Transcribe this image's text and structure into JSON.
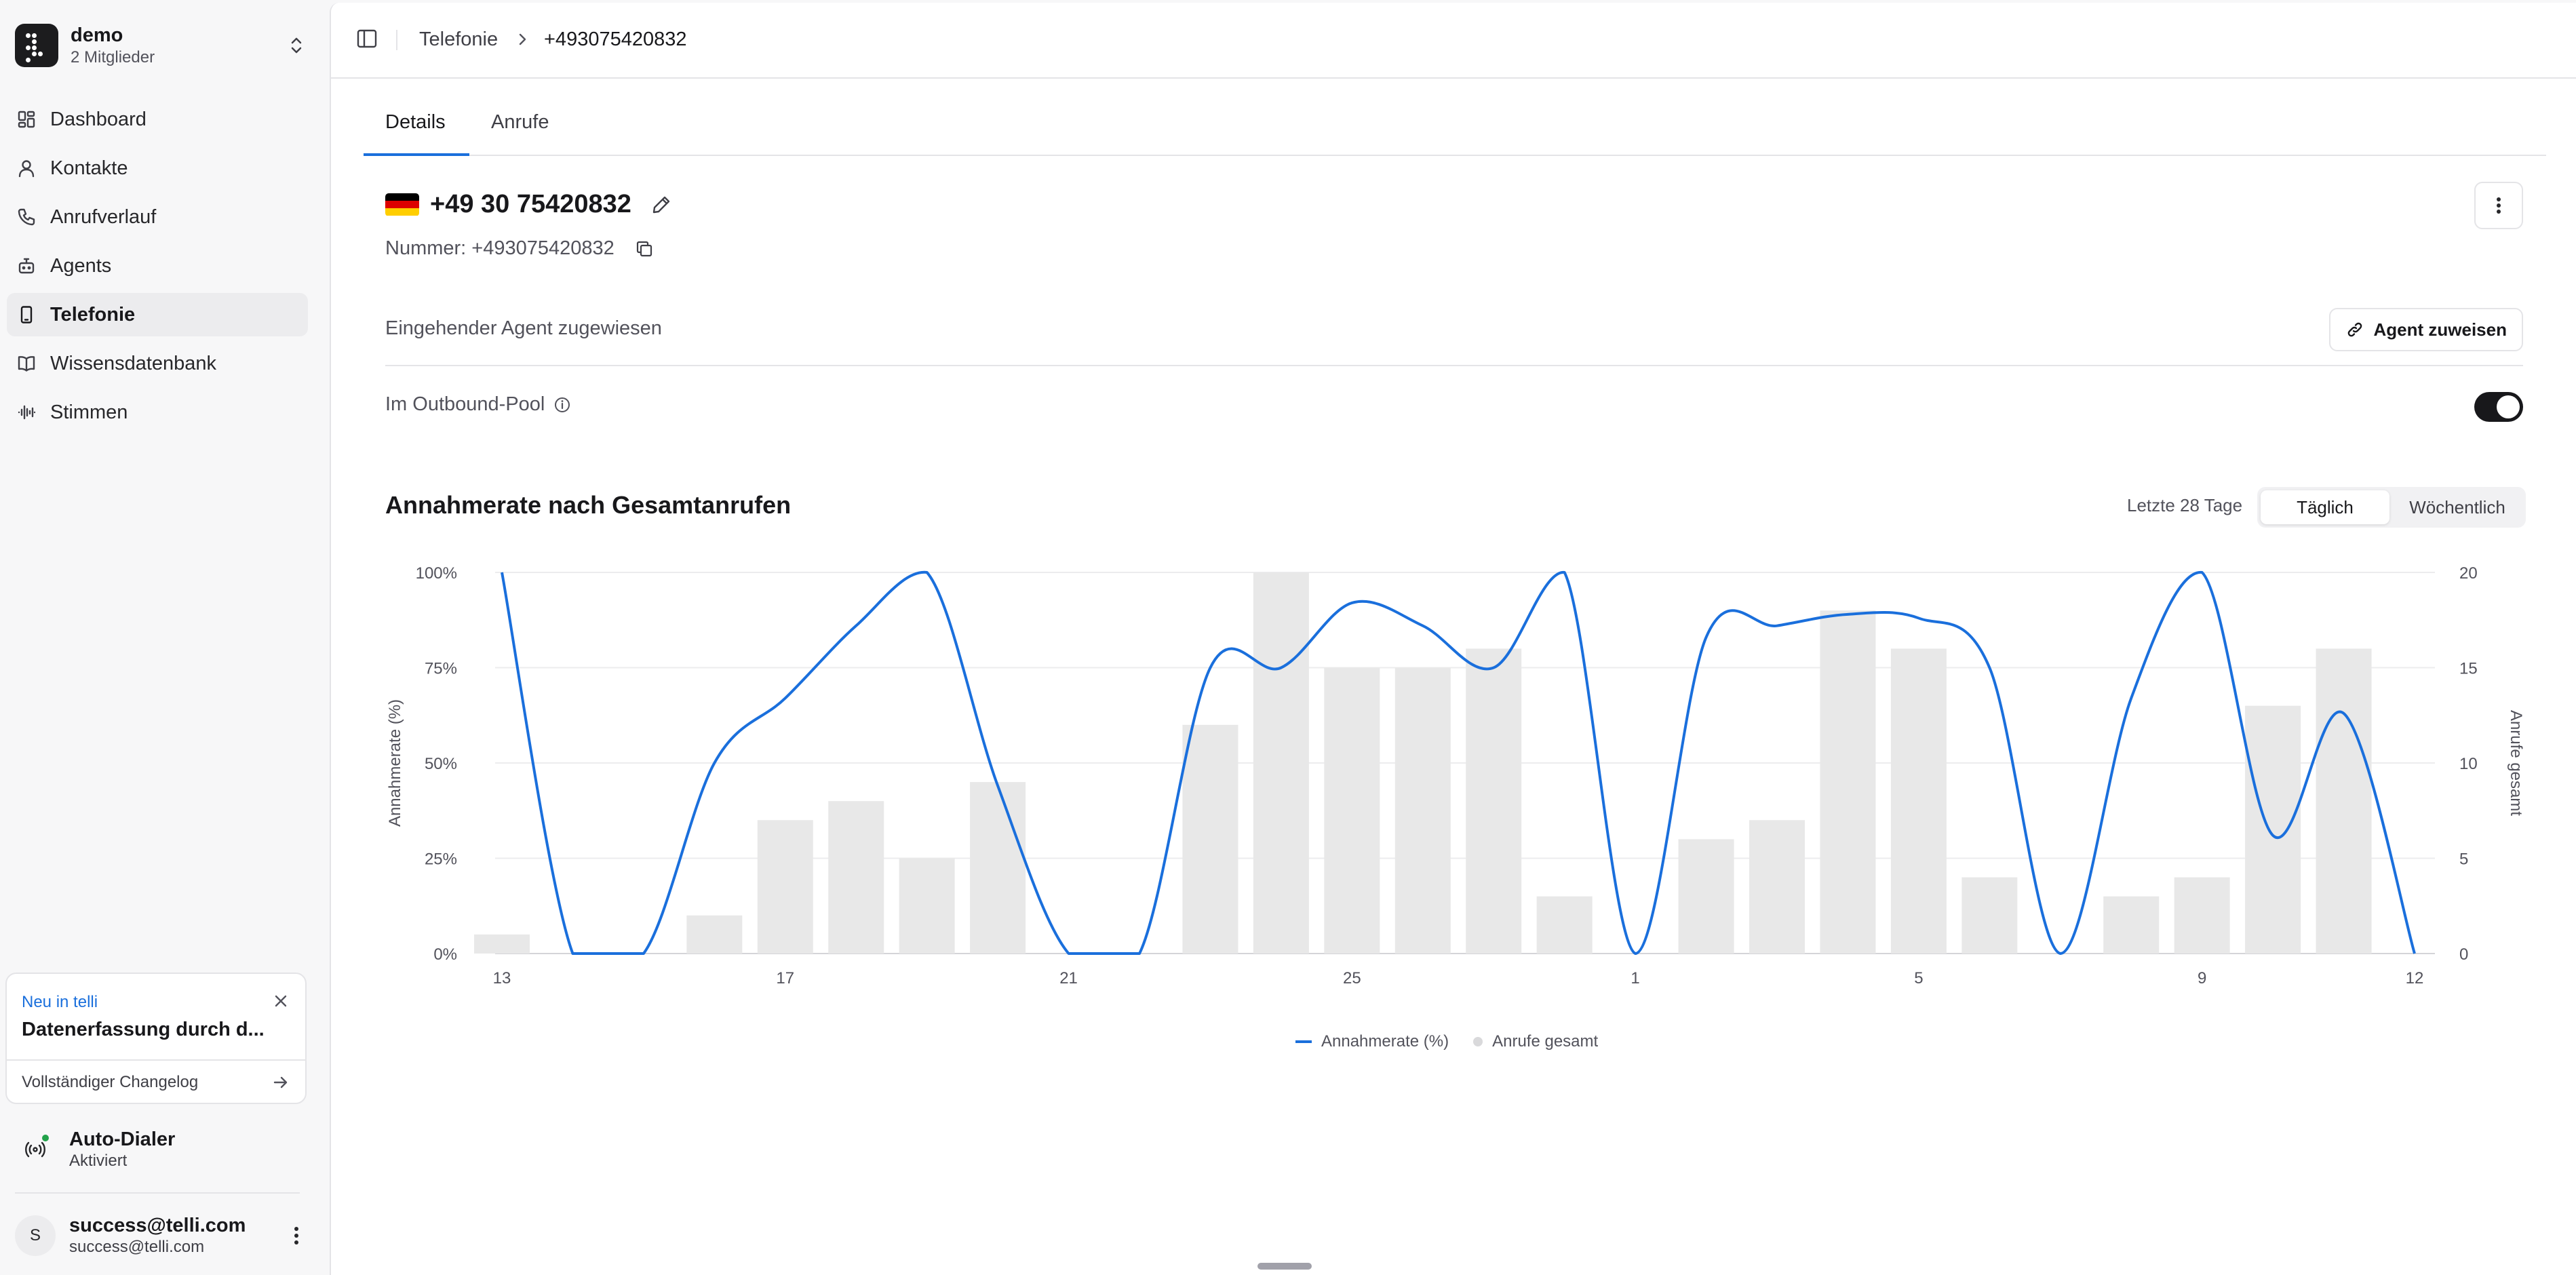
{
  "workspace": {
    "name": "demo",
    "members": "2 Mitglieder"
  },
  "sidebar": {
    "items": [
      {
        "label": "Dashboard",
        "icon": "dashboard-icon"
      },
      {
        "label": "Kontakte",
        "icon": "person-icon"
      },
      {
        "label": "Anrufverlauf",
        "icon": "phone-icon"
      },
      {
        "label": "Agents",
        "icon": "bot-icon"
      },
      {
        "label": "Telefonie",
        "icon": "smartphone-icon",
        "active": true
      },
      {
        "label": "Wissensdatenbank",
        "icon": "book-icon"
      },
      {
        "label": "Stimmen",
        "icon": "audio-waveform-icon"
      }
    ]
  },
  "news": {
    "tag": "Neu in",
    "tag_brand": "telli",
    "title": "Datenerfassung durch d...",
    "link": "Vollständiger Changelog"
  },
  "dialer": {
    "title": "Auto-Dialer",
    "status": "Aktiviert",
    "status_color": "#22a24a"
  },
  "user": {
    "initial": "S",
    "name": "success@telli.com",
    "email": "success@telli.com"
  },
  "breadcrumb": {
    "section": "Telefonie",
    "current": "+493075420832"
  },
  "tabs": [
    {
      "label": "Details",
      "active": true
    },
    {
      "label": "Anrufe",
      "active": false
    }
  ],
  "number": {
    "display": "+49 30 75420832",
    "raw_label": "Nummer: +493075420832",
    "flag": [
      "#000000",
      "#dd0000",
      "#ffce00"
    ]
  },
  "inbound": {
    "label": "Eingehender Agent zugewiesen",
    "button": "Agent zuweisen"
  },
  "outbound": {
    "label": "Im Outbound-Pool",
    "enabled": true
  },
  "chart_section": {
    "title": "Annahmerate nach Gesamtanrufen",
    "range_label": "Letzte 28 Tage",
    "toggle": {
      "daily": "Täglich",
      "weekly": "Wöchentlich",
      "selected": "daily"
    }
  },
  "chart_data": {
    "type": "bar",
    "title": "Annahmerate nach Gesamtanrufen",
    "categories": [
      "13",
      "14",
      "15",
      "16",
      "17",
      "18",
      "19",
      "20",
      "21",
      "22",
      "23",
      "24",
      "25",
      "26",
      "27",
      "28",
      "1",
      "2",
      "3",
      "4",
      "5",
      "6",
      "7",
      "8",
      "9",
      "10",
      "11",
      "12"
    ],
    "x_tick_labels": [
      "13",
      "17",
      "21",
      "25",
      "1",
      "5",
      "9",
      "12"
    ],
    "series": [
      {
        "name": "Annahmerate (%)",
        "kind": "line",
        "axis": "left",
        "color": "#1a6fdc",
        "values": [
          100,
          0,
          0,
          50,
          67,
          86,
          100,
          44,
          0,
          0,
          75,
          75,
          92,
          86,
          75,
          100,
          0,
          83,
          86,
          89,
          88,
          75,
          0,
          67,
          100,
          31,
          63,
          0
        ]
      },
      {
        "name": "Anrufe gesamt",
        "kind": "bar",
        "axis": "right",
        "color": "#e8e8e8",
        "values": [
          1,
          0,
          0,
          2,
          7,
          8,
          5,
          9,
          0,
          0,
          12,
          20,
          15,
          15,
          16,
          3,
          0,
          6,
          7,
          18,
          16,
          4,
          0,
          3,
          4,
          13,
          16,
          0
        ]
      }
    ],
    "ylabel": "Annahmerate (%)",
    "ylabel_right": "Anrufe gesamt",
    "ylim": [
      0,
      100
    ],
    "ylim_right": [
      0,
      20
    ],
    "y_ticks": [
      "0%",
      "25%",
      "50%",
      "75%",
      "100%"
    ],
    "y_ticks_right": [
      "0",
      "5",
      "10",
      "15",
      "20"
    ],
    "grid": true,
    "legend": "bottom-center"
  }
}
